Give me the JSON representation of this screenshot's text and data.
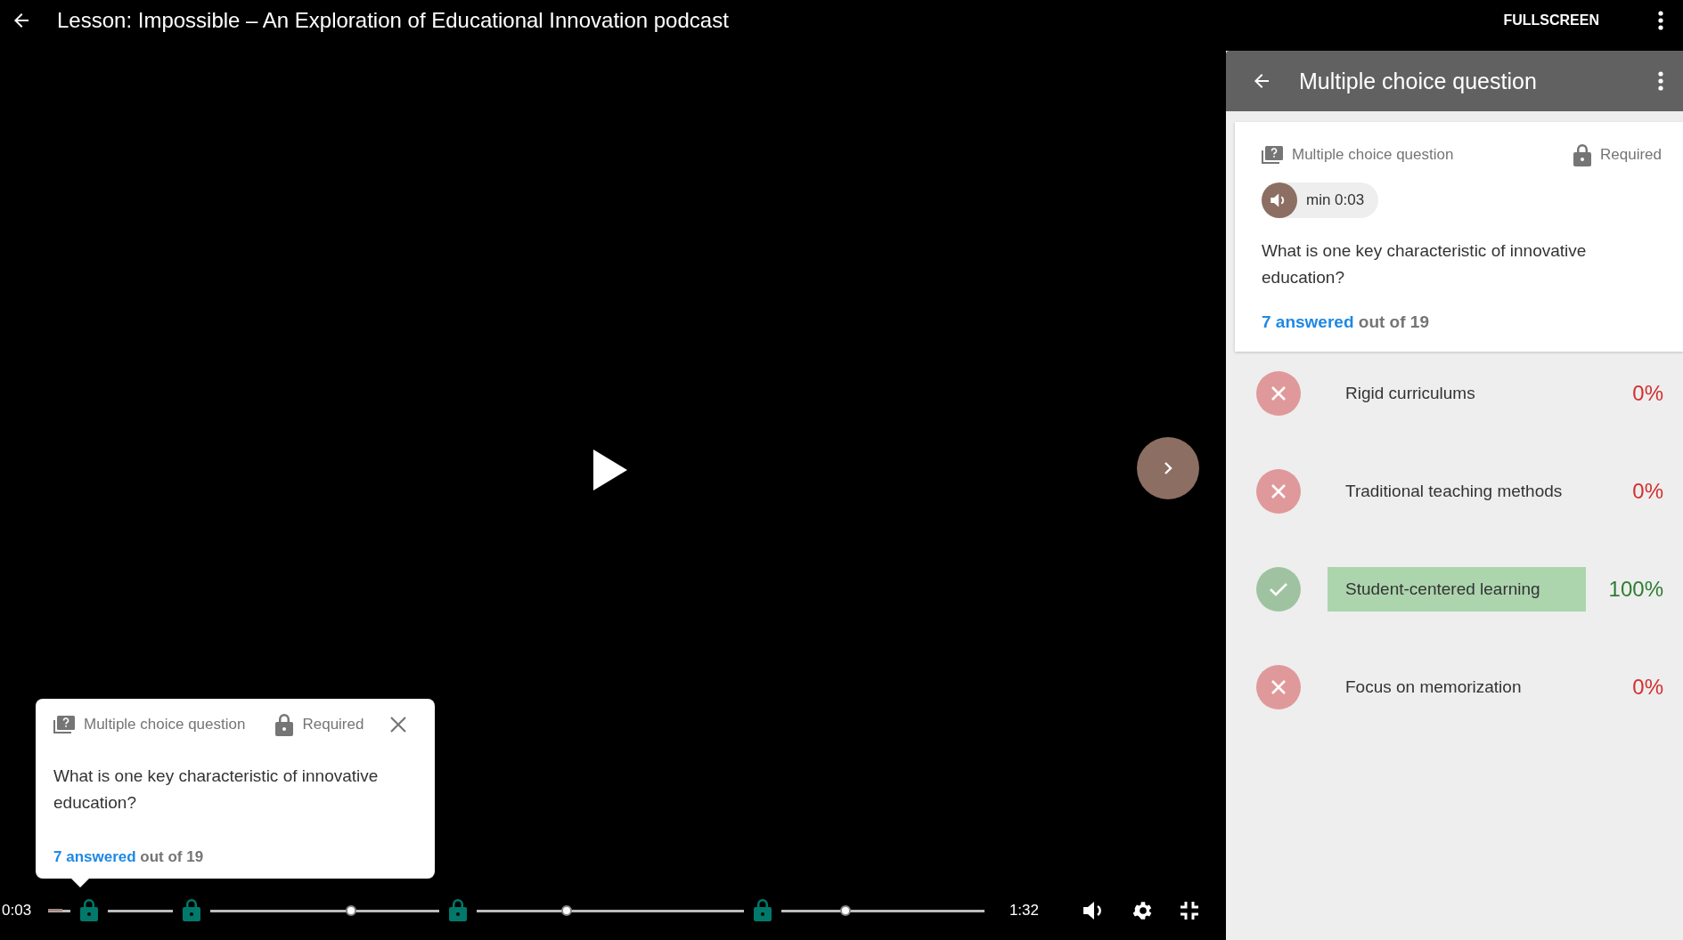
{
  "top_bar": {
    "title": "Lesson: Impossible – An Exploration of Educational Innovation podcast",
    "fullscreen_label": "FULLSCREEN"
  },
  "player": {
    "popup": {
      "type_label": "Multiple choice question",
      "required_label": "Required",
      "question": "What is one key characteristic of innovative education?",
      "answered": "7 answered",
      "answered_rest": "out of 19"
    },
    "controls": {
      "current_time": "0:03",
      "duration": "1:32",
      "level": 0.015
    }
  },
  "panel": {
    "title": "Multiple choice question",
    "card": {
      "type_label": "Multiple choice question",
      "required_label": "Required",
      "audio_chip": "min 0:03",
      "question": "What is one key characteristic of innovative education?",
      "answered": "7 answered",
      "answered_rest": "out of 19"
    },
    "options": [
      {
        "label": "Rigid curriculums",
        "percent": "0%",
        "correct": false
      },
      {
        "label": "Traditional teaching methods",
        "percent": "0%",
        "correct": false
      },
      {
        "label": "Student-centered learning",
        "percent": "100%",
        "correct": true
      },
      {
        "label": "Focus on memorization",
        "percent": "0%",
        "correct": false
      }
    ]
  }
}
